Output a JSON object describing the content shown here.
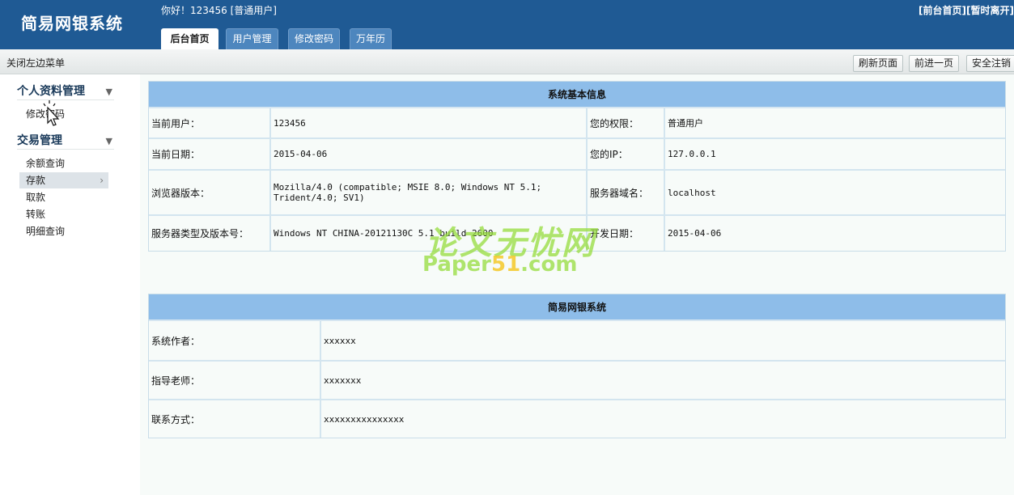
{
  "header": {
    "logo": "简易网银系统",
    "greeting": "你好！123456 [普通用户]",
    "links": [
      "[前台首页]",
      "[暂时离开]"
    ],
    "tabs": [
      "后台首页",
      "用户管理",
      "修改密码",
      "万年历"
    ]
  },
  "toolbar": {
    "toggle_label": "关闭左边菜单",
    "buttons": [
      "刷新页面",
      "前进一页",
      "安全注销"
    ]
  },
  "sidebar": {
    "groups": [
      {
        "title": "个人资料管理",
        "items": [
          "修改密码"
        ]
      },
      {
        "title": "交易管理",
        "items": [
          "余额查询",
          "存款",
          "取款",
          "转账",
          "明细查询"
        ]
      }
    ]
  },
  "system_info": {
    "title": "系统基本信息",
    "rows": [
      [
        "当前用户：",
        "123456",
        "您的权限：",
        "普通用户"
      ],
      [
        "当前日期：",
        "2015-04-06",
        "您的IP：",
        "127.0.0.1"
      ],
      [
        "浏览器版本：",
        "Mozilla/4.0 (compatible; MSIE 8.0; Windows NT 5.1; Trident/4.0; SV1)",
        "服务器域名：",
        "localhost"
      ],
      [
        "服务器类型及版本号：",
        "Windows NT CHINA-20121130C 5.1 build 2600",
        "开发日期：",
        "2015-04-06"
      ]
    ]
  },
  "about": {
    "title": "简易网银系统",
    "rows": [
      [
        "系统作者：",
        "xxxxxx"
      ],
      [
        "指导老师：",
        "xxxxxxx"
      ],
      [
        "联系方式：",
        "xxxxxxxxxxxxxxx"
      ]
    ]
  },
  "watermark": {
    "cn": "论文无忧网",
    "en_prefix": "Paper",
    "en_num": "51",
    "en_suffix": ".com"
  },
  "icons": {
    "expand": "triangle-down-icon",
    "submenu": "chevron-right-icon",
    "cursor": "hand-cursor-icon"
  }
}
